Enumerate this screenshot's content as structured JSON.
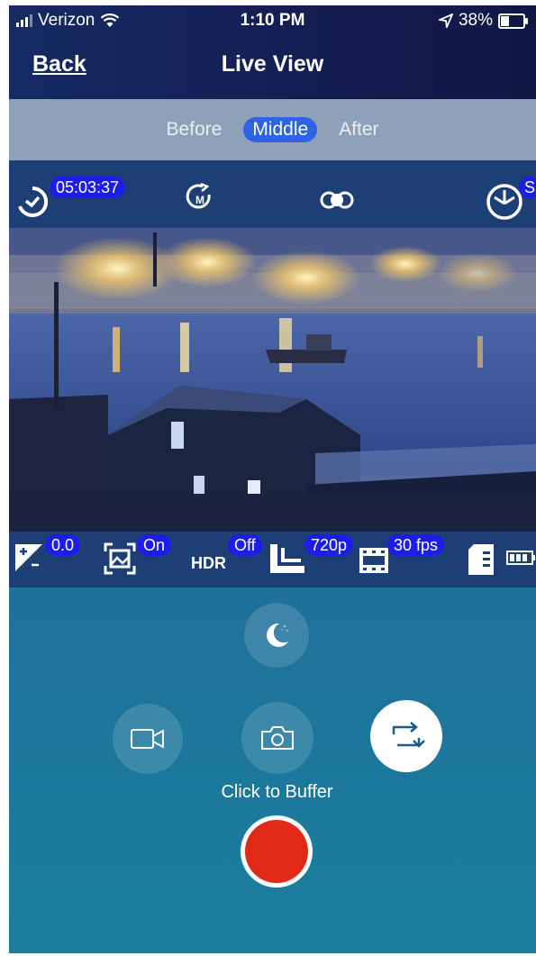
{
  "status_bar": {
    "carrier": "Verizon",
    "time": "1:10 PM",
    "battery": "38%"
  },
  "nav": {
    "back_label": "Back",
    "title": "Live View"
  },
  "segments": [
    {
      "label": "Before",
      "active": false
    },
    {
      "label": "Middle",
      "active": true
    },
    {
      "label": "After",
      "active": false
    }
  ],
  "camera_header": {
    "timer": "05:03:37",
    "badge_right": "S",
    "icons": [
      "timer-icon",
      "loop-mode-icon",
      "camera-link-icon",
      "shutter-icon"
    ]
  },
  "settings": {
    "exposure": "0.0",
    "stabilization": "On",
    "hdr_label": "HDR",
    "hdr": "Off",
    "resolution": "720p",
    "framerate": "30 fps"
  },
  "controls": {
    "buffer_label": "Click to Buffer"
  },
  "colors": {
    "accent_pill": "#1d1dea",
    "record": "#e02a17",
    "segment_active": "#2f63e6"
  }
}
